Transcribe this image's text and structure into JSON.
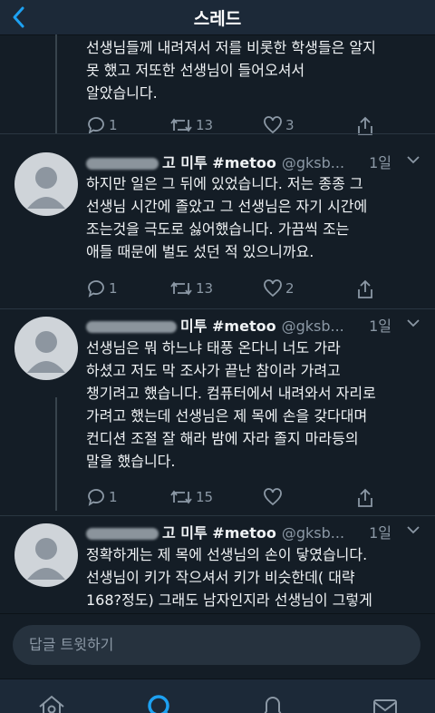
{
  "header": {
    "title": "스레드"
  },
  "tweets": [
    {
      "lines": [
        "선생님들께 내려져서 저를 비롯한 학생들은 알지",
        "못 했고 저또한 선생님이 들어오셔서",
        "알았습니다."
      ],
      "replies": "1",
      "retweets": "13",
      "likes": "3"
    },
    {
      "name": "고 미투 #metoo",
      "handle": "@gksb...",
      "age": "1일",
      "lines": [
        "하지만 일은 그 뒤에 있었습니다. 저는 종종 그",
        "선생님 시간에 졸았고 그 선생님은 자기 시간에",
        "조는것을 극도로 싫어했습니다. 가끔씩 조는",
        "애들 때문에 벌도 섰던 적 있으니까요."
      ],
      "replies": "1",
      "retweets": "13",
      "likes": "2"
    },
    {
      "name": "미투 #metoo",
      "handle": "@gksb...",
      "age": "1일",
      "lines": [
        "선생님은 뭐 하느냐 태풍 온다니 너도 가라",
        "하셨고 저도 막 조사가 끝난 참이라 가려고",
        "챙기려고 했습니다. 컴퓨터에서 내려와서 자리로",
        "가려고 했는데 선생님은 제 목에 손을 갖다대며",
        "컨디션 조절 잘 해라 밤에 자라 졸지 마라등의",
        "말을 했습니다."
      ],
      "replies": "1",
      "retweets": "15",
      "likes": ""
    },
    {
      "name": "고 미투 #metoo",
      "handle": "@gksb...",
      "age": "1일",
      "lines": [
        "정확하게는 제 목에 선생님의 손이 닿였습니다.",
        "선생님이 키가 작으셔서 키가 비슷한데( 대략",
        "168?정도) 그래도 남자인지라 선생님이 그렇게"
      ]
    }
  ],
  "reply_bar": {
    "placeholder": "답글 트윗하기"
  },
  "icons": [
    "back-chevron-icon",
    "reply-icon",
    "retweet-icon",
    "like-icon",
    "share-icon",
    "caret-down-icon",
    "home-icon",
    "search-icon",
    "notifications-icon",
    "messages-icon"
  ],
  "colors": {
    "background": "#141d26",
    "accent": "#1da1f2",
    "muted": "#8b98a5"
  }
}
